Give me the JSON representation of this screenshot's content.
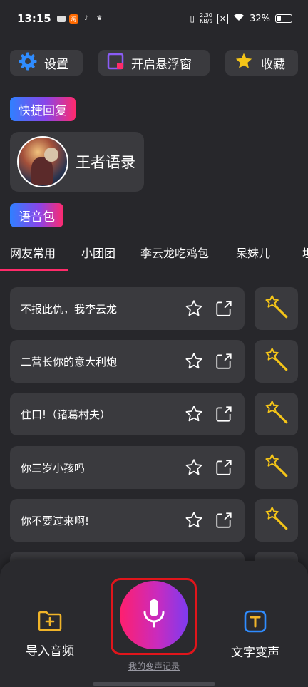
{
  "status_bar": {
    "time": "13:15",
    "net_speed_value": "2.30",
    "net_speed_unit": "KB/s",
    "battery": "32%"
  },
  "top_buttons": {
    "settings": "设置",
    "floating_window": "开启悬浮窗",
    "favorites": "收藏"
  },
  "quick_reply": {
    "label": "快捷回复"
  },
  "card": {
    "title": "王者语录"
  },
  "voice_pack": {
    "label": "语音包"
  },
  "tabs": [
    "网友常用",
    "小团团",
    "李云龙吃鸡包",
    "呆妹儿",
    "坦"
  ],
  "phrases": [
    "不报此仇，我李云龙",
    "二营长你的意大利炮",
    "住口!（诸葛村夫）",
    "你三岁小孩吗",
    "你不要过来啊!"
  ],
  "bottom": {
    "import_audio": "导入音频",
    "text_to_voice": "文字变声",
    "my_records": "我的变声记录"
  },
  "colors": {
    "accent_pink": "#ff2b6a",
    "panel_bg": "#3a3a3e",
    "record_border": "#e0151b"
  }
}
